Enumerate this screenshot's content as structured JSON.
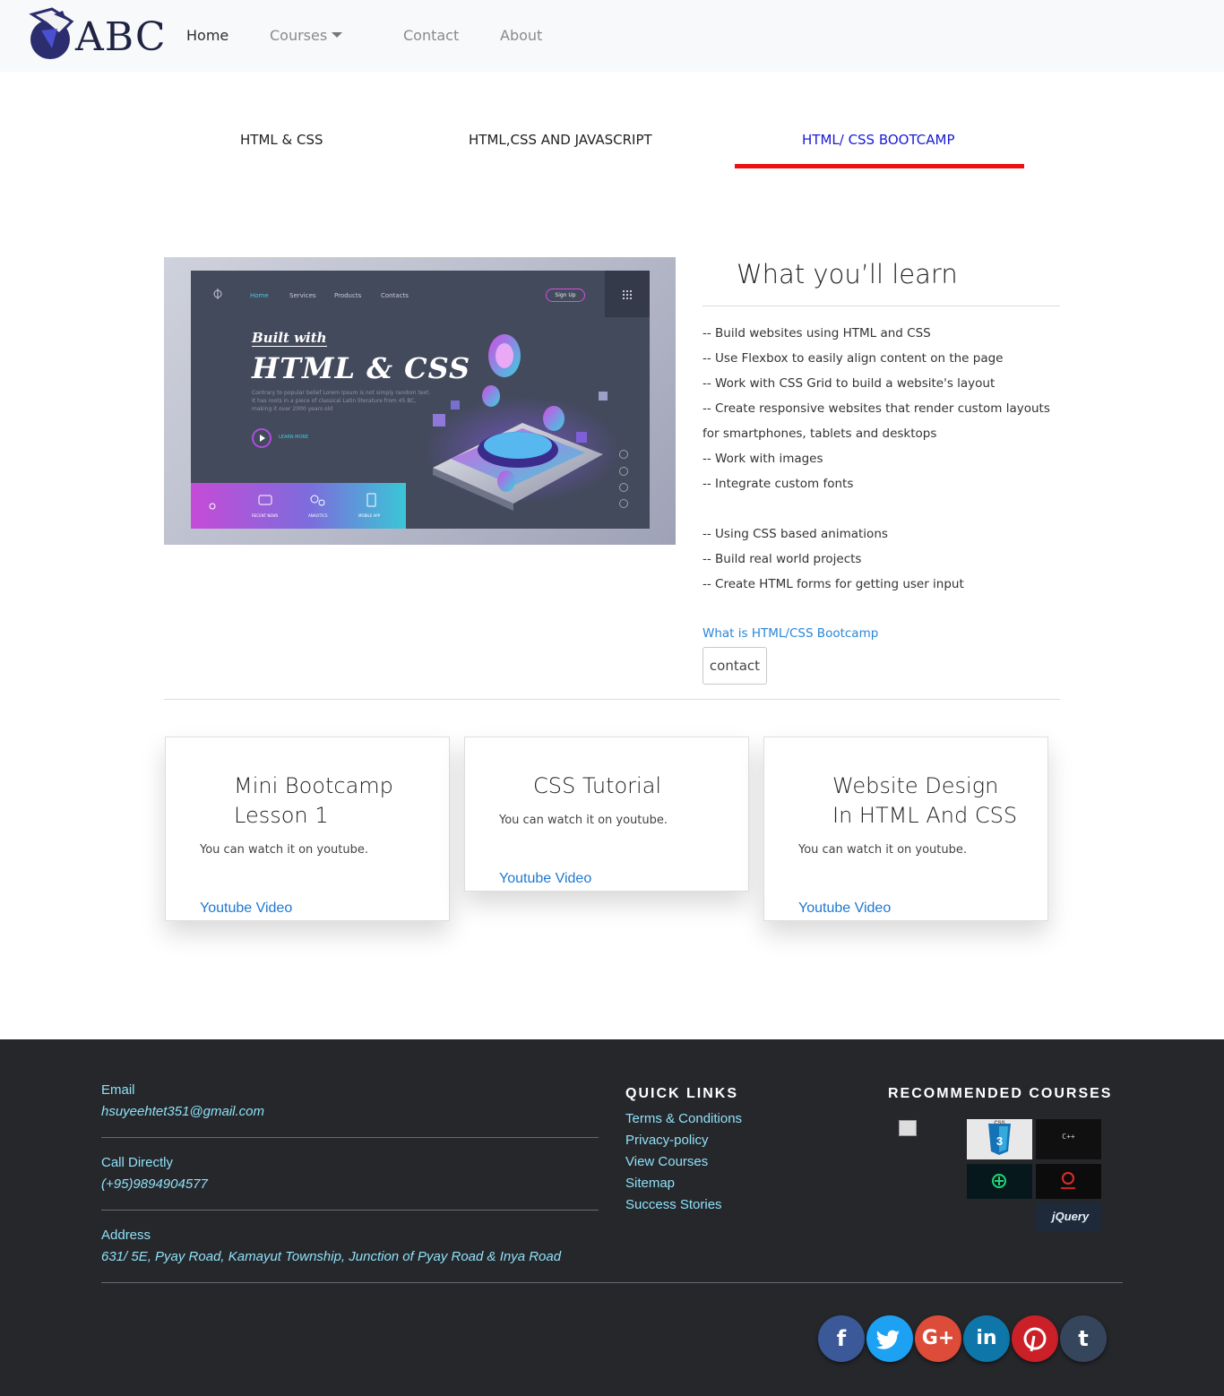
{
  "brand": {
    "logo_text": "ABC"
  },
  "nav": {
    "home": "Home",
    "courses": "Courses",
    "contact": "Contact",
    "about": "About"
  },
  "tabs": [
    {
      "label": "HTML & CSS"
    },
    {
      "label": "HTML,CSS AND JAVASCRIPT"
    },
    {
      "label": "HTML/ CSS BOOTCAMP"
    }
  ],
  "hero_image": {
    "nav": [
      "Home",
      "Services",
      "Products",
      "Contacts"
    ],
    "signup": "Sign Up",
    "built_with": "Built with",
    "title": "HTML & CSS",
    "body": "Contrary to popular belief Lorem Ipsum is not simply random text. It has roots in a piece of classical Latin literature from 45 BC, making it over 2000 years old",
    "learn_more": "LEARN MORE",
    "bar_labels": [
      "RECENT NEWS",
      "ANALYTICS",
      "MOBILE APP"
    ]
  },
  "learn": {
    "title": "What you’ll learn",
    "items": [
      "-- Build websites using HTML and CSS",
      "-- Use Flexbox to easily align content on the page",
      "-- Work with CSS Grid to build a website's layout",
      "-- Create responsive websites that render custom layouts for smartphones, tablets and desktops",
      "-- Work with images",
      "-- Integrate custom fonts"
    ],
    "items2": [
      "-- Using CSS based animations",
      "-- Build real world projects",
      "-- Create HTML forms for getting user input"
    ],
    "link": "What is HTML/CSS Bootcamp",
    "button": "contact"
  },
  "cards": [
    {
      "title": "Mini Bootcamp Lesson 1",
      "text": "You can watch it on youtube.",
      "link": "Youtube Video"
    },
    {
      "title": "CSS Tutorial",
      "text": "You can watch it on youtube.",
      "link": "Youtube Video"
    },
    {
      "title": "Website Design In HTML And CSS",
      "text": "You can watch it on youtube.",
      "link": "Youtube Video"
    }
  ],
  "footer": {
    "email_label": "Email",
    "email_value": "hsuyeehtet351@gmail.com",
    "call_label": "Call Directly",
    "call_value": "(+95)9894904577",
    "address_label": "Address",
    "address_value": "631/ 5E, Pyay Road, Kamayut Township, Junction of Pyay Road & Inya Road",
    "quick_links_heading": "QUICK LINKS",
    "quick_links": [
      "Terms & Conditions",
      "Privacy-policy",
      "View Courses",
      "Sitemap",
      "Success Stories"
    ],
    "recommended_heading": "RECOMMENDED COURSES",
    "thumb_labels": {
      "css": "CSS",
      "css_num": "3",
      "cpp": "C++",
      "jquery": "jQuery"
    },
    "social": [
      {
        "name": "facebook",
        "glyph": "f",
        "color": "#3b5998"
      },
      {
        "name": "twitter",
        "glyph": "t",
        "color": "#1da1f2"
      },
      {
        "name": "google-plus",
        "glyph": "G+",
        "color": "#dd4b39"
      },
      {
        "name": "linkedin",
        "glyph": "in",
        "color": "#0e76a8"
      },
      {
        "name": "pinterest",
        "glyph": "P",
        "color": "#cb2027"
      },
      {
        "name": "tumblr",
        "glyph": "t",
        "color": "#35465c"
      }
    ]
  },
  "colors": {
    "active_tab": "#1a1ad6",
    "tab_underline": "#ee1111",
    "link": "#1f78d1",
    "footer_bg": "#25272b",
    "footer_text": "#8fe0f7"
  }
}
